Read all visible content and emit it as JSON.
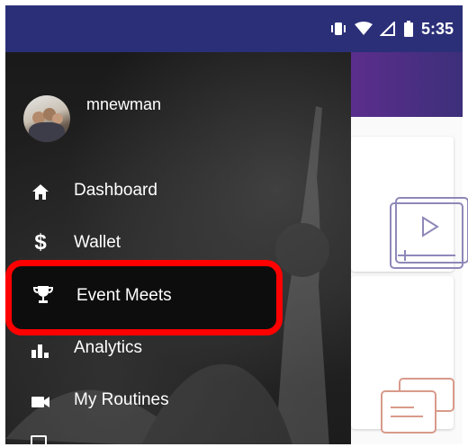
{
  "status_bar": {
    "time": "5:35",
    "icons": [
      "vibrate-icon",
      "wifi-icon",
      "signal-icon",
      "battery-icon"
    ]
  },
  "drawer": {
    "username": "mnewman",
    "items": [
      {
        "label": "Dashboard",
        "icon": "home-icon"
      },
      {
        "label": "Wallet",
        "icon": "dollar-icon"
      },
      {
        "label": "Event Meets",
        "icon": "trophy-icon"
      },
      {
        "label": "Analytics",
        "icon": "bar-chart-icon"
      },
      {
        "label": "My Routines",
        "icon": "video-camera-icon"
      }
    ],
    "highlighted_item": "Event Meets",
    "highlight_color": "#ff0000"
  },
  "colors": {
    "status_bar": "#2b2f78",
    "app_bar_gradient": [
      "#5b2e8c",
      "#3d2f7a"
    ],
    "card_icon": "#8e88b8",
    "card_icon_2": "#d99a8a"
  }
}
